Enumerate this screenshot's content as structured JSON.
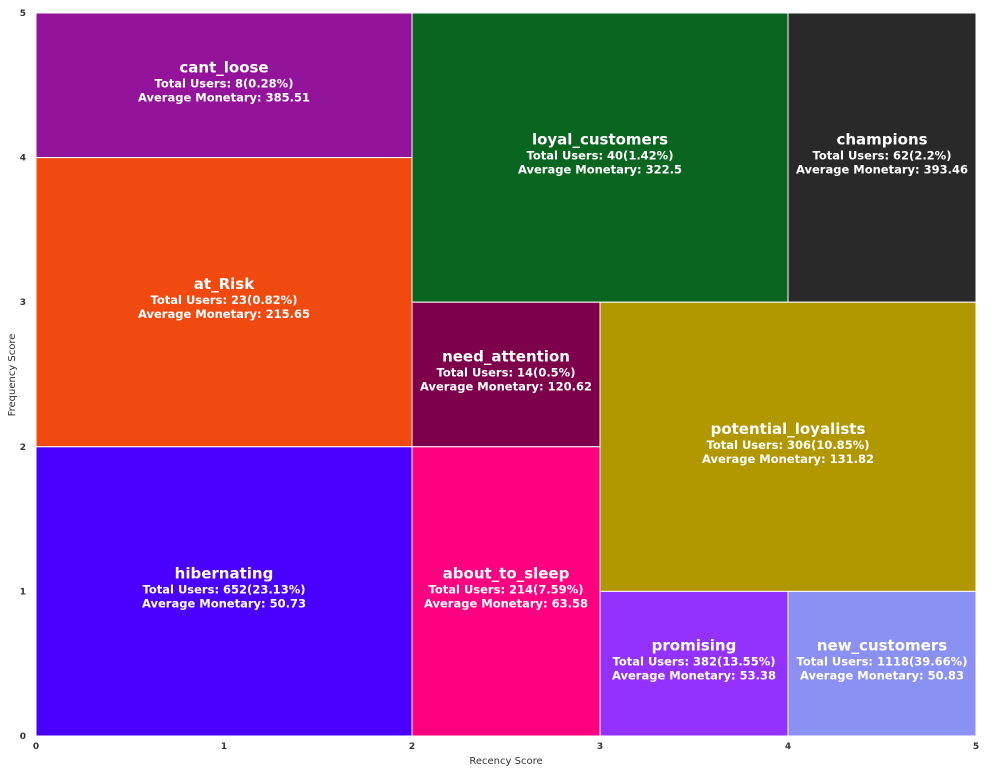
{
  "chart_data": {
    "type": "treemap",
    "xlabel": "Recency Score",
    "ylabel": "Frequency Score",
    "xlim": [
      0,
      5
    ],
    "ylim": [
      0,
      5
    ],
    "x_ticks": [
      "0",
      "1",
      "2",
      "3",
      "4",
      "5"
    ],
    "y_ticks": [
      "0",
      "1",
      "2",
      "3",
      "4",
      "5"
    ],
    "grid": false,
    "segments": [
      {
        "name": "cant_loose",
        "x0": 0,
        "x1": 2,
        "y0": 4,
        "y1": 5,
        "color": "#93139a",
        "users_line": "Total Users: 8(0.28%)",
        "monetary_line": "Average Monetary: 385.51",
        "total_users": 8,
        "percent": 0.28,
        "avg_monetary": 385.51
      },
      {
        "name": "at_Risk",
        "x0": 0,
        "x1": 2,
        "y0": 2,
        "y1": 4,
        "color": "#f04a11",
        "users_line": "Total Users: 23(0.82%)",
        "monetary_line": "Average Monetary: 215.65",
        "total_users": 23,
        "percent": 0.82,
        "avg_monetary": 215.65
      },
      {
        "name": "hibernating",
        "x0": 0,
        "x1": 2,
        "y0": 0,
        "y1": 2,
        "color": "#4a00ff",
        "users_line": "Total Users: 652(23.13%)",
        "monetary_line": "Average Monetary: 50.73",
        "total_users": 652,
        "percent": 23.13,
        "avg_monetary": 50.73
      },
      {
        "name": "loyal_customers",
        "x0": 2,
        "x1": 4,
        "y0": 3,
        "y1": 5,
        "color": "#0a6520",
        "users_line": "Total Users: 40(1.42%)",
        "monetary_line": "Average Monetary: 322.5",
        "total_users": 40,
        "percent": 1.42,
        "avg_monetary": 322.5
      },
      {
        "name": "champions",
        "x0": 4,
        "x1": 5,
        "y0": 3,
        "y1": 5,
        "color": "#292929",
        "users_line": "Total Users: 62(2.2%)",
        "monetary_line": "Average Monetary: 393.46",
        "total_users": 62,
        "percent": 2.2,
        "avg_monetary": 393.46
      },
      {
        "name": "need_attention",
        "x0": 2,
        "x1": 3,
        "y0": 2,
        "y1": 3,
        "color": "#7c004a",
        "users_line": "Total Users: 14(0.5%)",
        "monetary_line": "Average Monetary: 120.62",
        "total_users": 14,
        "percent": 0.5,
        "avg_monetary": 120.62
      },
      {
        "name": "potential_loyalists",
        "x0": 3,
        "x1": 5,
        "y0": 1,
        "y1": 3,
        "color": "#b19800",
        "users_line": "Total Users: 306(10.85%)",
        "monetary_line": "Average Monetary: 131.82",
        "total_users": 306,
        "percent": 10.85,
        "avg_monetary": 131.82
      },
      {
        "name": "about_to_sleep",
        "x0": 2,
        "x1": 3,
        "y0": 0,
        "y1": 2,
        "color": "#ff0080",
        "users_line": "Total Users: 214(7.59%)",
        "monetary_line": "Average Monetary: 63.58",
        "total_users": 214,
        "percent": 7.59,
        "avg_monetary": 63.58
      },
      {
        "name": "promising",
        "x0": 3,
        "x1": 4,
        "y0": 0,
        "y1": 1,
        "color": "#9332ff",
        "users_line": "Total Users: 382(13.55%)",
        "monetary_line": "Average Monetary: 53.38",
        "total_users": 382,
        "percent": 13.55,
        "avg_monetary": 53.38
      },
      {
        "name": "new_customers",
        "x0": 4,
        "x1": 5,
        "y0": 0,
        "y1": 1,
        "color": "#8a91f2",
        "users_line": "Total Users: 1118(39.66%)",
        "monetary_line": "Average Monetary: 50.83",
        "total_users": 1118,
        "percent": 39.66,
        "avg_monetary": 50.83
      }
    ]
  }
}
